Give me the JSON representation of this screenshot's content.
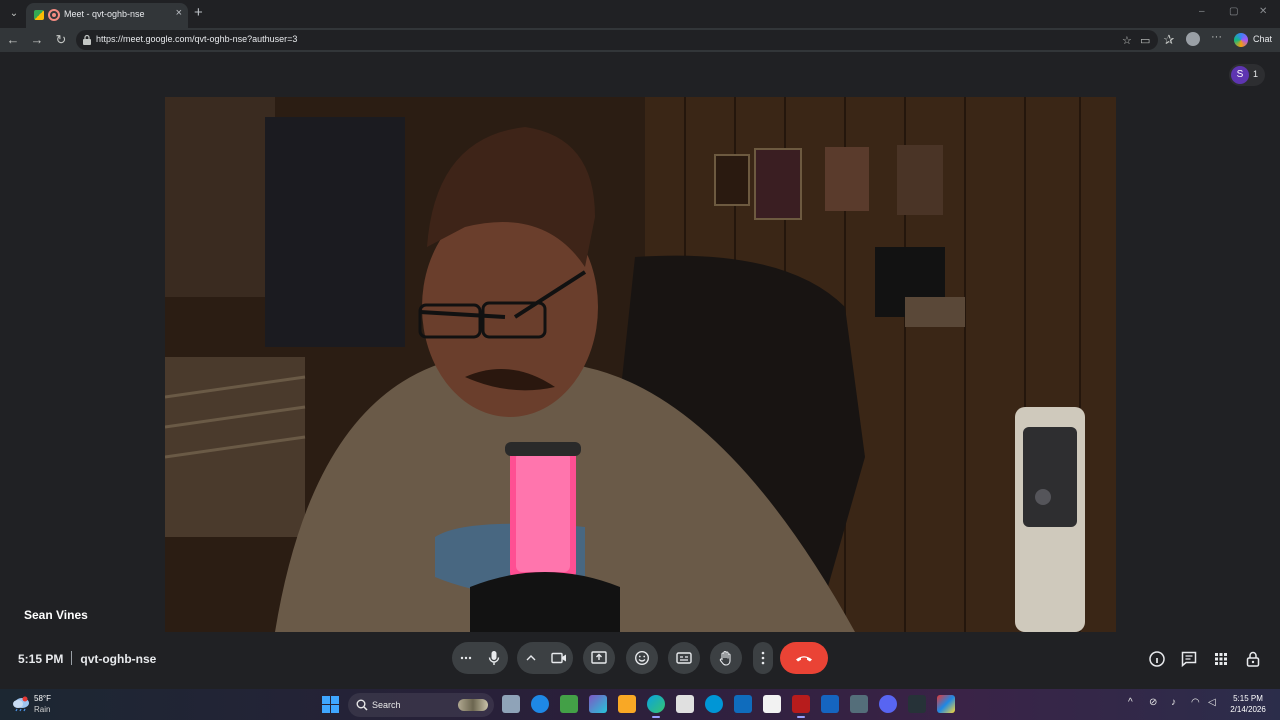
{
  "browser": {
    "tab_title": "Meet - qvt-oghb-nse",
    "tab_close": "×",
    "new_tab": "+",
    "url": "https://meet.google.com/qvt-oghb-nse?authuser=3",
    "copilot_label": "Chat",
    "window_controls": {
      "minimize": "–",
      "maximize": "▢",
      "close": "✕"
    }
  },
  "meet": {
    "participant_initial": "S",
    "participant_count": "1",
    "speaker_name": "Sean Vines",
    "time": "5:15 PM",
    "meeting_code": "qvt-oghb-nse",
    "end_call_color": "#ea4335",
    "controls": [
      "more-options",
      "microphone",
      "camera-options",
      "camera",
      "present",
      "emoji",
      "captions",
      "raise-hand",
      "more-actions",
      "leave-call"
    ],
    "right_controls": [
      "meeting-details",
      "chat",
      "activities",
      "host-controls"
    ]
  },
  "taskbar": {
    "temperature": "58°F",
    "condition": "Rain",
    "search_label": "Search",
    "time": "5:15 PM",
    "date": "2/14/2026"
  }
}
